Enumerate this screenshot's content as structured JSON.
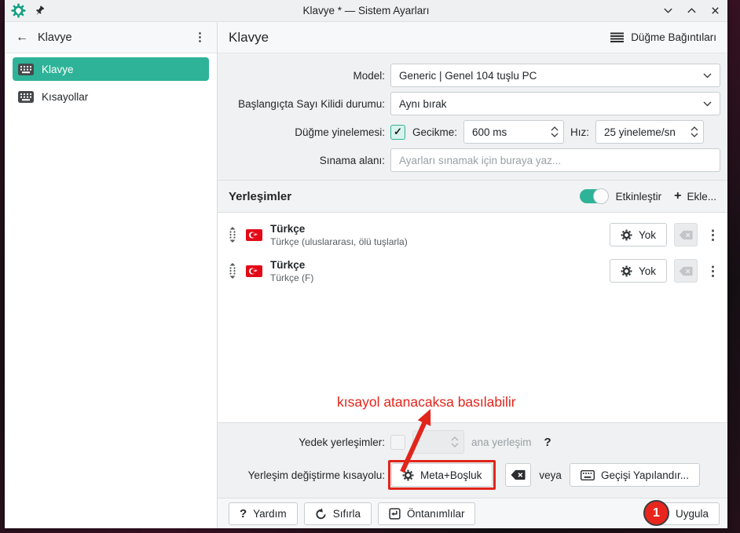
{
  "window": {
    "title": "Klavye * — Sistem Ayarları"
  },
  "sidebar": {
    "header": "Klavye",
    "items": [
      {
        "label": "Klavye",
        "selected": true
      },
      {
        "label": "Kısayollar",
        "selected": false
      }
    ]
  },
  "main": {
    "header": {
      "title": "Klavye",
      "button_mappings": "Düğme Bağıntıları"
    },
    "form": {
      "model_label": "Model:",
      "model_value": "Generic | Genel 104 tuşlu PC",
      "numlock_label": "Başlangıçta Sayı Kilidi durumu:",
      "numlock_value": "Aynı bırak",
      "repeat_label": "Düğme yinelemesi:",
      "delay_label": "Gecikme:",
      "delay_value": "600 ms",
      "rate_label": "Hız:",
      "rate_value": "25 yineleme/sn",
      "test_label": "Sınama alanı:",
      "test_placeholder": "Ayarları sınamak için buraya yaz..."
    },
    "layouts": {
      "title": "Yerleşimler",
      "enable_label": "Etkinleştir",
      "add_label": "Ekle...",
      "rows": [
        {
          "name": "Türkçe",
          "variant": "Türkçe (uluslararası, ölü tuşlarla)",
          "shortcut": "Yok"
        },
        {
          "name": "Türkçe",
          "variant": "Türkçe (F)",
          "shortcut": "Yok"
        }
      ]
    },
    "bottom": {
      "spare_label": "Yedek yerleşimler:",
      "spare_suffix": "ana yerleşim",
      "help_mark": "?",
      "switch_label": "Yerleşim değiştirme kısayolu:",
      "switch_shortcut": "Meta+Boşluk",
      "or_label": "veya",
      "configure_label": "Geçişi Yapılandır..."
    },
    "footer": {
      "help": "Yardım",
      "reset": "Sıfırla",
      "defaults": "Öntanımlılar",
      "apply": "Uygula"
    }
  },
  "annotation": {
    "text": "kısayol atanacaksa basılabilir",
    "badge": "1",
    "color": "#e1251b"
  },
  "glyphs": {
    "back_arrow": "←",
    "kebab": "⋮",
    "plus": "+",
    "check": "✓",
    "question": "?"
  },
  "colors": {
    "accent": "#2eb398",
    "annotation_red": "#e1251b",
    "flag_red": "#e30a17"
  }
}
